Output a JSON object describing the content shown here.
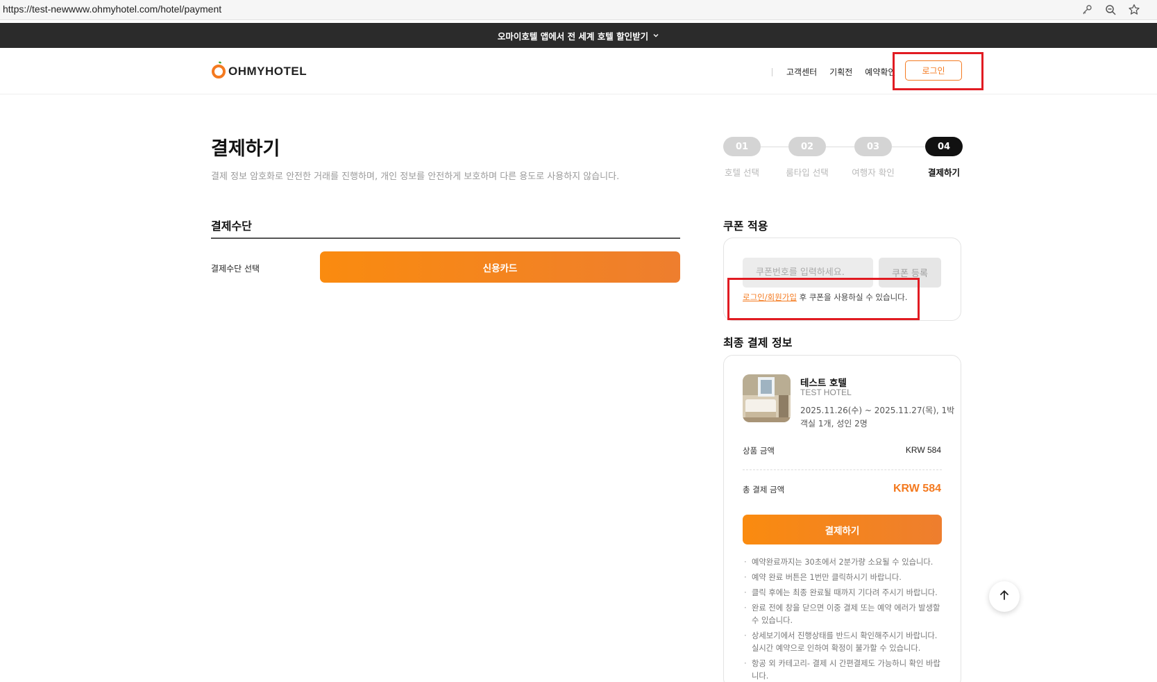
{
  "browser": {
    "url": "https://test-newwww.ohmyhotel.com/hotel/payment",
    "icons": [
      "key-icon",
      "zoom-out-icon",
      "star-icon"
    ]
  },
  "promo": {
    "text": "오마이호텔 앱에서 전 세계 호텔 할인받기"
  },
  "header": {
    "logo_text": "OHMYHOTEL",
    "nav": [
      "고객센터",
      "기획전",
      "예약확인"
    ],
    "login_label": "로그인"
  },
  "page": {
    "title": "결제하기",
    "description": "결제 정보 암호화로 안전한 거래를 진행하며, 개인 정보를 안전하게 보호하며 다른 용도로 사용하지 않습니다."
  },
  "steps": [
    {
      "num": "01",
      "label": "호텔 선택",
      "active": false
    },
    {
      "num": "02",
      "label": "룸타입 선택",
      "active": false
    },
    {
      "num": "03",
      "label": "여행자 확인",
      "active": false
    },
    {
      "num": "04",
      "label": "결제하기",
      "active": true
    }
  ],
  "payment": {
    "section_title": "결제수단",
    "select_label": "결제수단 선택",
    "method_label": "신용카드"
  },
  "coupon": {
    "section_title": "쿠폰 적용",
    "input_placeholder": "쿠폰번호를 입력하세요.",
    "register_label": "쿠폰 등록",
    "login_link": "로그인/회원가입",
    "note_suffix": " 후 쿠폰을 사용하실 수 있습니다."
  },
  "summary": {
    "section_title": "최종 결제 정보",
    "hotel_name": "테스트 호텔",
    "hotel_name_en": "TEST HOTEL",
    "dates": "2025.11.26(수) ~ 2025.11.27(목), 1박",
    "room": "객실 1개, 성인 2명",
    "product_label": "상품 금액",
    "product_value": "KRW 584",
    "total_label": "총 결제 금액",
    "total_value": "KRW 584",
    "pay_label": "결제하기",
    "notes": [
      "예약완료까지는 30초에서 2분가량 소요될 수 있습니다.",
      "예약 완료 버튼은 1번만 클릭하시기 바랍니다.",
      "클릭 후에는 최종 완료될 때까지 기다려 주시기 바랍니다.",
      "완료 전에 창을 닫으면 이중 결제 또는 예약 에러가 발생할 수 있습니다.",
      "상세보기에서 진행상태를 반드시 확인해주시기 바랍니다. 실시간 예약으로 인하여 확정이 불가할 수 있습니다.",
      "항공 외 카테고리- 결제 시 간편결제도 가능하니 확인 바랍니다."
    ]
  },
  "colors": {
    "brand": "#f47a20",
    "highlight": "#e11b22"
  }
}
